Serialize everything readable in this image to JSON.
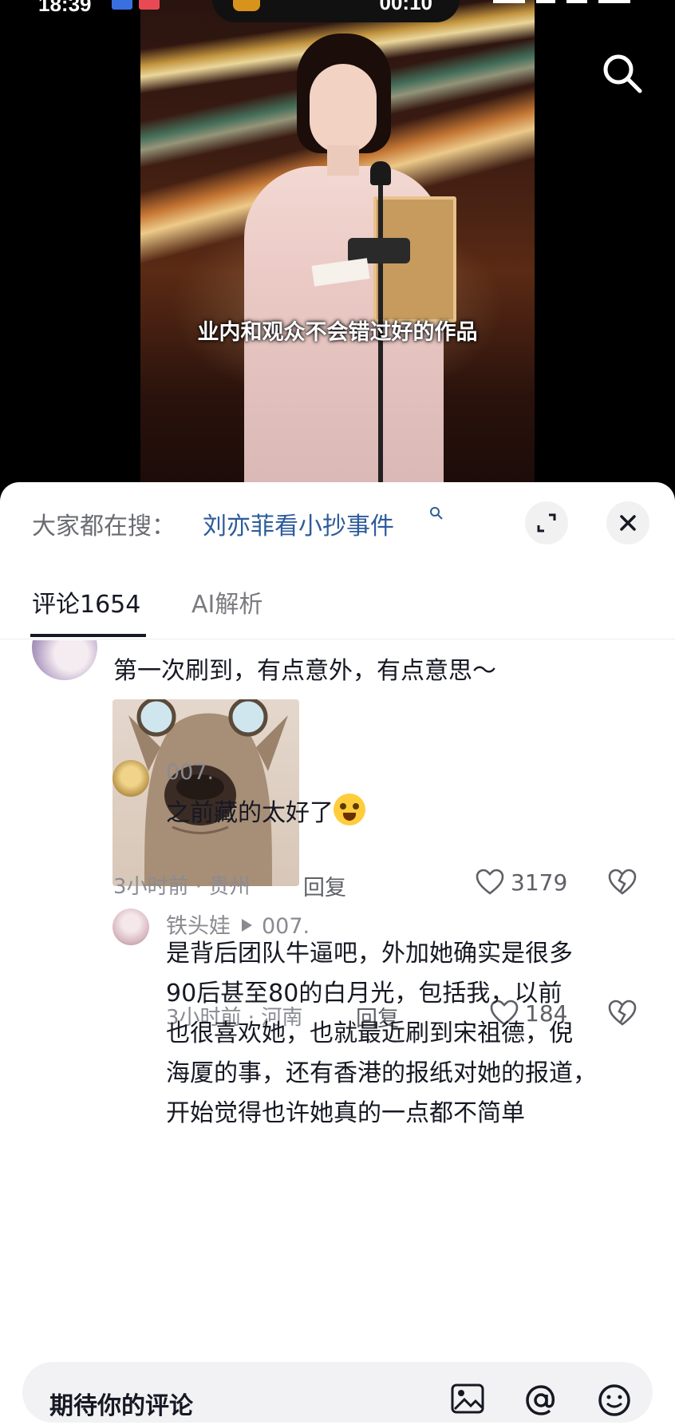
{
  "status_bar": {
    "time": "18:39",
    "pill_time": "00:10"
  },
  "video": {
    "subtitle": "业内和观众不会错过好的作品"
  },
  "trending": {
    "label": "大家都在搜：",
    "query": "刘亦菲看小抄事件"
  },
  "tabs": [
    {
      "label": "评论1654"
    },
    {
      "label": "AI解析"
    }
  ],
  "comments": [
    {
      "text": "第一次刷到，有点意外，有点意思～",
      "meta": "3小时前 · 贵州",
      "reply_label": "回复",
      "likes": "3179"
    },
    {
      "username": "007.",
      "text": "之前藏的太好了",
      "meta": "3小时前 · 河南",
      "reply_label": "回复",
      "likes": "184"
    },
    {
      "username": "铁头娃",
      "reply_to": "007.",
      "lines": [
        "是背后团队牛逼吧，外加她确实是很多",
        "90后甚至80的白月光，包括我，以前",
        "也很喜欢她，也就最近刷到宋祖德，倪",
        "海厦的事，还有香港的报纸对她的报道，",
        "开始觉得也许她真的一点都不简单"
      ]
    }
  ],
  "input": {
    "text": "期待你的评论"
  },
  "colors": {
    "link": "#2d5b9a",
    "muted": "#8a8b91",
    "text": "#161823"
  }
}
